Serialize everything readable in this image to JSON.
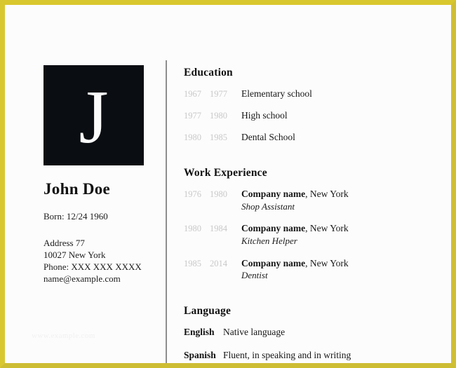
{
  "document": {
    "type": "resume-template",
    "border_color": "#d9c72f",
    "background_color": "#fcfcfc"
  },
  "profile": {
    "photo_letter": "J",
    "name": "John Doe",
    "born": "Born: 12/24 1960",
    "address_line1": "Address 77",
    "address_line2": "10027 New York",
    "phone": "Phone: XXX XXX XXXX",
    "email": "name@example.com"
  },
  "watermark": {
    "text": "www.example.com"
  },
  "education": {
    "title": "Education",
    "entries": [
      {
        "start": "1967",
        "end": "1977",
        "name": "Elementary school"
      },
      {
        "start": "1977",
        "end": "1980",
        "name": "High school"
      },
      {
        "start": "1980",
        "end": "1985",
        "name": "Dental School"
      }
    ]
  },
  "work": {
    "title": "Work Experience",
    "entries": [
      {
        "start": "1976",
        "end": "1980",
        "company": "Company name",
        "location": ", New York",
        "role": "Shop Assistant"
      },
      {
        "start": "1980",
        "end": "1984",
        "company": "Company name",
        "location": ", New York",
        "role": "Kitchen Helper"
      },
      {
        "start": "1985",
        "end": "2014",
        "company": "Company name",
        "location": ", New York",
        "role": "Dentist"
      }
    ]
  },
  "language": {
    "title": "Language",
    "entries": [
      {
        "name": "English",
        "level": "Native language"
      },
      {
        "name": "Spanish",
        "level": "Fluent, in speaking and in writing"
      }
    ]
  }
}
